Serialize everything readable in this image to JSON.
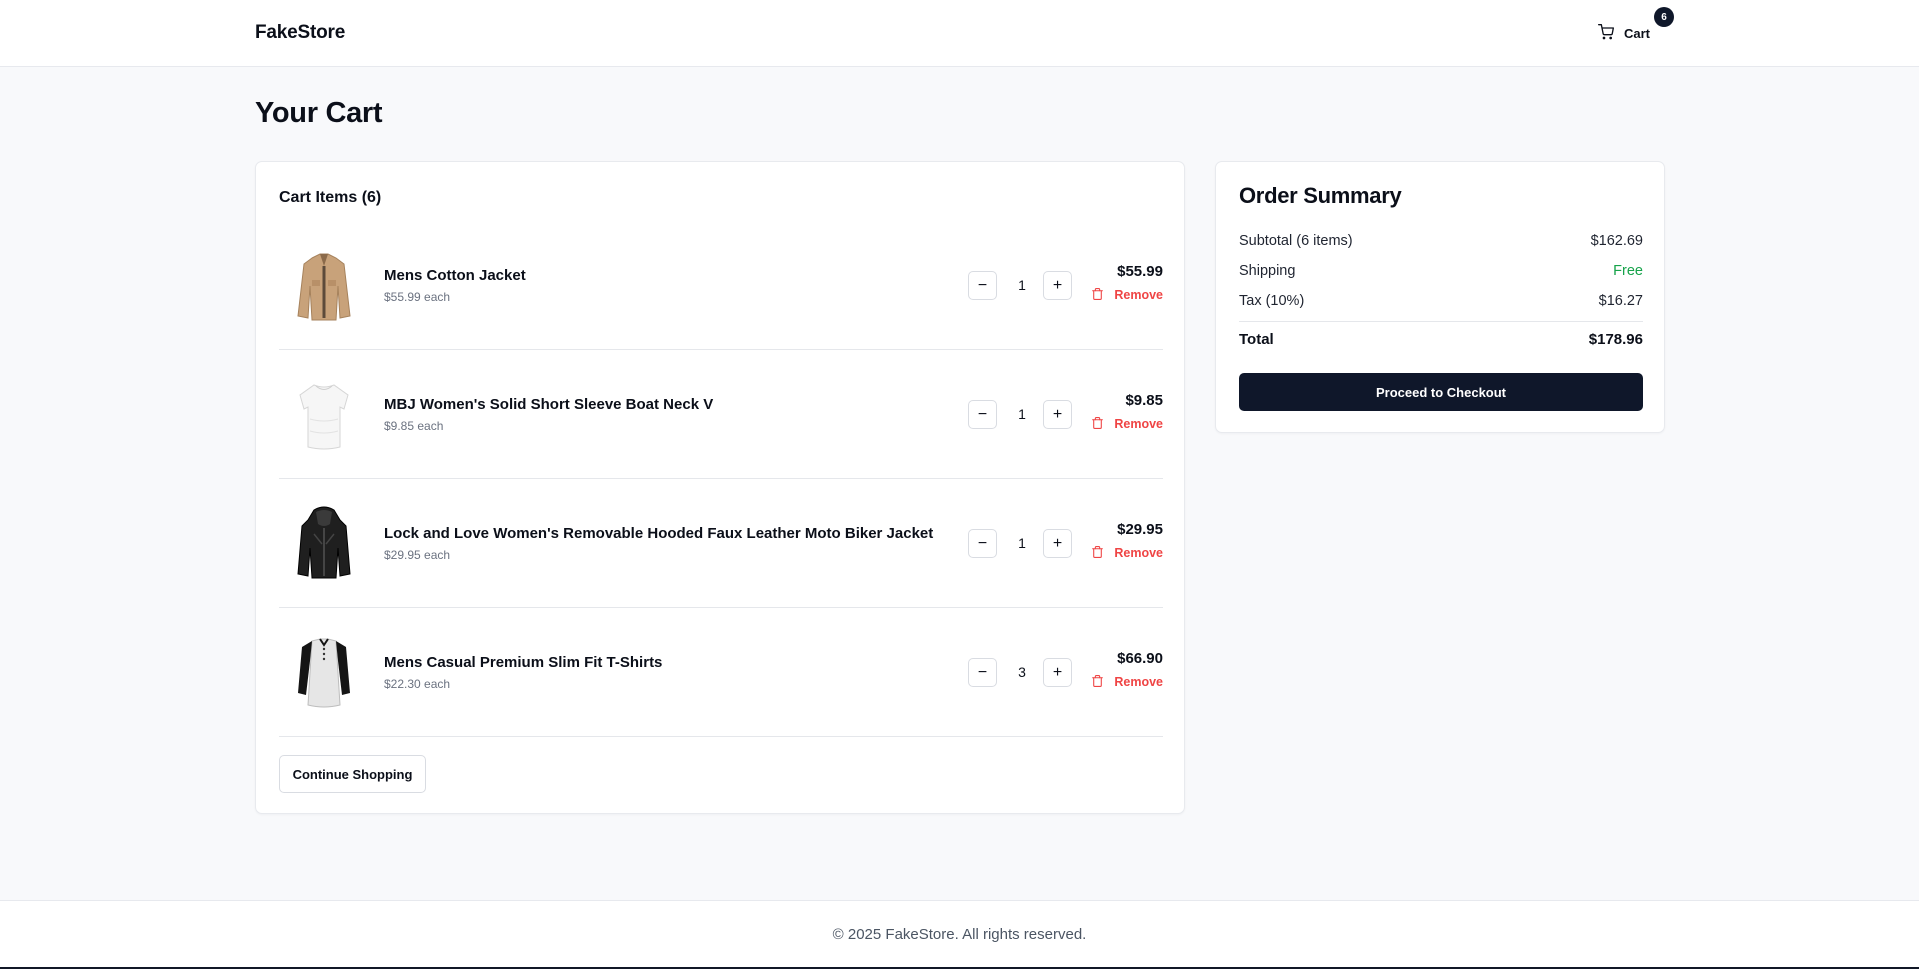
{
  "header": {
    "logo": "FakeStore",
    "cart_label": "Cart",
    "cart_count": "6"
  },
  "page": {
    "title": "Your Cart"
  },
  "cart": {
    "title": "Cart Items (6)",
    "items": [
      {
        "name": "Mens Cotton Jacket",
        "each": "$55.99 each",
        "qty": "1",
        "total": "$55.99",
        "remove": "Remove",
        "image": "jacket-tan"
      },
      {
        "name": "MBJ Women's Solid Short Sleeve Boat Neck V",
        "each": "$9.85 each",
        "qty": "1",
        "total": "$9.85",
        "remove": "Remove",
        "image": "white-top"
      },
      {
        "name": "Lock and Love Women's Removable Hooded Faux Leather Moto Biker Jacket",
        "each": "$29.95 each",
        "qty": "1",
        "total": "$29.95",
        "remove": "Remove",
        "image": "black-leather-jacket"
      },
      {
        "name": "Mens Casual Premium Slim Fit T-Shirts",
        "each": "$22.30 each",
        "qty": "3",
        "total": "$66.90",
        "remove": "Remove",
        "image": "raglan-tee"
      }
    ],
    "minus_symbol": "−",
    "plus_symbol": "+",
    "continue_label": "Continue Shopping"
  },
  "summary": {
    "title": "Order Summary",
    "subtotal_label": "Subtotal (6 items)",
    "subtotal_value": "$162.69",
    "shipping_label": "Shipping",
    "shipping_value": "Free",
    "tax_label": "Tax (10%)",
    "tax_value": "$16.27",
    "total_label": "Total",
    "total_value": "$178.96",
    "checkout_label": "Proceed to Checkout"
  },
  "footer": {
    "text": "© 2025 FakeStore. All rights reserved."
  },
  "colors": {
    "accent_dark": "#0f172a",
    "remove_red": "#ef4444",
    "free_green": "#16a34a",
    "page_bg": "#f8f9fb"
  },
  "icons": {
    "cart": "shopping-cart-icon",
    "remove": "trash-icon"
  }
}
